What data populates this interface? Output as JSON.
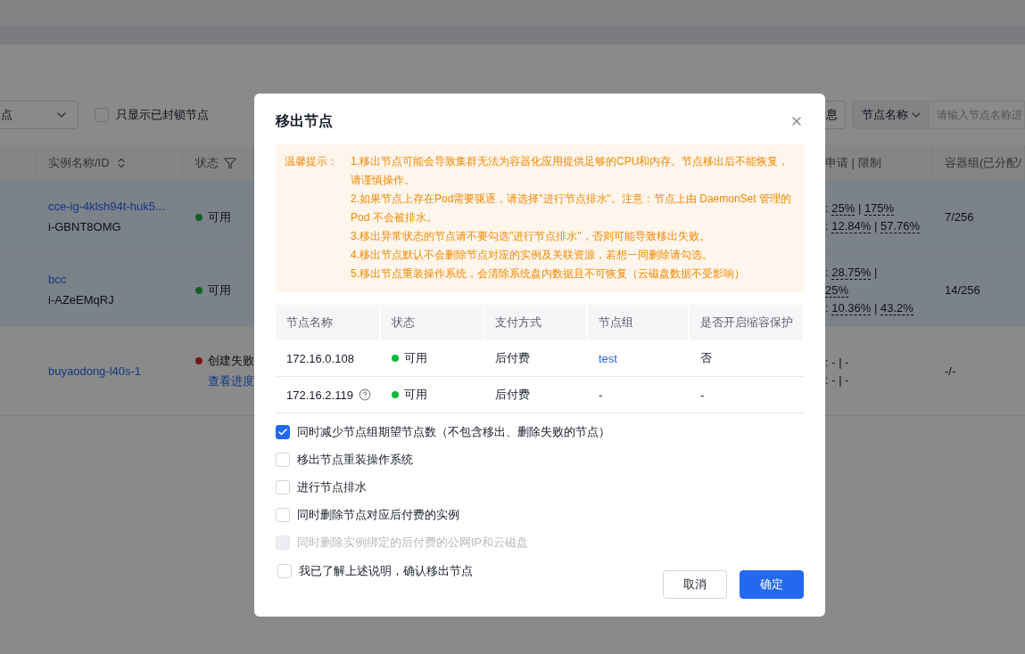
{
  "toolbar": {
    "node_select": "点",
    "locked_only": {
      "label": "只显示已封锁节点",
      "checked": false
    },
    "info_button": "息",
    "search_type": "节点名称",
    "search": {
      "placeholder": "请输入节点名称进"
    }
  },
  "table": {
    "columns": [
      {
        "label": "实例名称/ID",
        "kind": "sort"
      },
      {
        "label": "状态",
        "kind": "filter"
      },
      {
        "label": "申请 | 限制",
        "kind": "plain"
      },
      {
        "label": "容器组(已分配/",
        "kind": "plain"
      }
    ],
    "rows": [
      {
        "selected": true,
        "name": "cce-ig-4klsh94t-huk5...",
        "id": "i-GBNT8OMG",
        "status": {
          "label": "可用",
          "kind": "available"
        },
        "usage": [
          [
            {
              "text": ": "
            },
            {
              "text": "25%",
              "dashed": true
            },
            {
              "text": " | "
            },
            {
              "text": "175%",
              "dashed": true
            }
          ],
          [
            {
              "text": ": "
            },
            {
              "text": "12.84%",
              "dashed": true
            },
            {
              "text": " | "
            },
            {
              "text": "57.76%",
              "dashed": true
            }
          ]
        ],
        "pods": "7/256"
      },
      {
        "selected": true,
        "name": "bcc",
        "id": "i-AZeEMqRJ",
        "status": {
          "label": "可用",
          "kind": "available"
        },
        "usage": [
          [
            {
              "text": ": "
            },
            {
              "text": "28.75%",
              "dashed": true
            },
            {
              "text": " |"
            }
          ],
          [
            {
              "text": "25%",
              "dashed": true
            }
          ],
          [
            {
              "text": ": "
            },
            {
              "text": "10.36%",
              "dashed": true
            },
            {
              "text": " | "
            },
            {
              "text": "43.2%",
              "dashed": true
            }
          ]
        ],
        "pods": "14/256"
      },
      {
        "selected": false,
        "name": "buyaodong-l40s-1",
        "status": {
          "label": "创建失败",
          "kind": "failed",
          "link": "查看进度"
        },
        "usage": [
          [
            {
              "text": ": - | -"
            }
          ],
          [
            {
              "text": ": - | -"
            }
          ]
        ],
        "pods": "-/-"
      }
    ]
  },
  "dialog": {
    "title": "移出节点",
    "notice": {
      "label": "温馨提示：",
      "items": [
        "1.移出节点可能会导致集群无法为容器化应用提供足够的CPU和内存。节点移出后不能恢复，请谨慎操作。",
        "2.如果节点上存在Pod需要驱逐，请选择\"进行节点排水\"。注意：节点上由 DaemonSet 管理的 Pod 不会被排水。",
        "3.移出异常状态的节点请不要勾选\"进行节点排水\"，否则可能导致移出失败。",
        "4.移出节点默认不会删除节点对应的实例及关联资源，若想一同删除请勾选。",
        "5.移出节点重装操作系统，会清除系统盘内数据且不可恢复（云磁盘数据不受影响）"
      ]
    },
    "columns": [
      "节点名称",
      "状态",
      "支付方式",
      "节点组",
      "是否开启缩容保护"
    ],
    "rows": [
      {
        "name": "172.16.0.108",
        "help": false,
        "status": {
          "label": "可用",
          "color": "#12b83c"
        },
        "billing": "后付费",
        "group": {
          "text": "test",
          "link": true
        },
        "protection": "否"
      },
      {
        "name": "172.16.2.119",
        "help": true,
        "status": {
          "label": "可用",
          "color": "#12b83c"
        },
        "billing": "后付费",
        "group": {
          "text": "-",
          "link": false
        },
        "protection": "-"
      }
    ],
    "options": [
      {
        "label": "同时减少节点组期望节点数（不包含移出、删除失败的节点）",
        "checked": true,
        "disabled": false
      },
      {
        "label": "移出节点重装操作系统",
        "checked": false,
        "disabled": false
      },
      {
        "label": "进行节点排水",
        "checked": false,
        "disabled": false
      },
      {
        "label": "同时删除节点对应后付费的实例",
        "checked": false,
        "disabled": false
      },
      {
        "label": "同时删除实例绑定的后付费的公网IP和云磁盘",
        "checked": false,
        "disabled": true
      }
    ],
    "confirm": {
      "label": "我已了解上述说明，确认移出节点",
      "checked": false
    },
    "buttons": [
      {
        "label": "取消",
        "kind": "secondary"
      },
      {
        "label": "确定",
        "kind": "primary"
      }
    ]
  }
}
